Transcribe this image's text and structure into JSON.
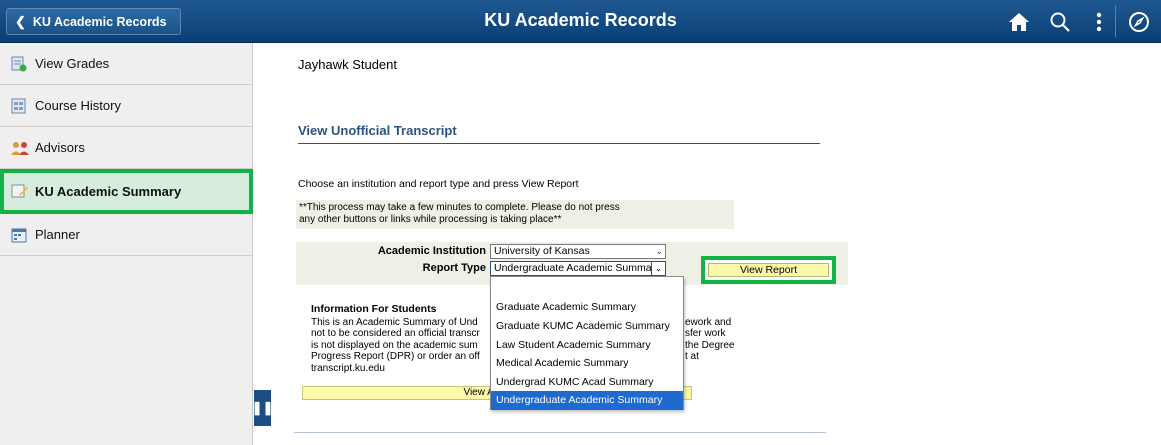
{
  "header": {
    "back_label": "KU Academic Records",
    "title": "KU Academic Records",
    "icons": [
      "home-icon",
      "search-icon",
      "more-menu-icon",
      "navigator-icon"
    ]
  },
  "sidebar": {
    "items": [
      {
        "label": "View Grades",
        "icon": "grades-icon"
      },
      {
        "label": "Course History",
        "icon": "course-history-icon"
      },
      {
        "label": "Advisors",
        "icon": "advisors-icon"
      },
      {
        "label": "KU Academic Summary",
        "icon": "summary-icon",
        "active": true
      },
      {
        "label": "Planner",
        "icon": "planner-icon"
      }
    ]
  },
  "main": {
    "student_name": "Jayhawk Student",
    "section_title": "View Unofficial Transcript",
    "instructions": "Choose an institution and report type and press View Report",
    "note_line1": "**This process may take a few minutes to complete. Please do not press",
    "note_line2": "any other buttons or links while processing is taking place**",
    "institution_label": "Academic Institution",
    "institution_value": "University of Kansas",
    "report_type_label": "Report Type",
    "report_type_value": "Undergraduate Academic Summa",
    "view_report_label": "View Report",
    "info_title": "Information For Students",
    "info_lines": [
      "This is an Academic Summary of Und",
      "not to be considered an official transcr",
      "is not displayed on the academic sum",
      "Progress Report (DPR) or order an off",
      "transcript.ku.edu"
    ],
    "info_lines_right": [
      "ework and",
      "sfer work",
      "the Degree",
      "t at"
    ],
    "view_all_label": "View All Reque",
    "dropdown_options": [
      "",
      "Graduate Academic Summary",
      "Graduate KUMC Academic Summary",
      "Law Student Academic Summary",
      "Medical Academic Summary",
      "Undergrad KUMC Acad Summary",
      "Undergraduate Academic Summary"
    ],
    "dropdown_selected_index": 6
  },
  "colors": {
    "header": "#0a3f76",
    "highlight": "#13b245",
    "section_title": "#2b5283",
    "button_fill": "#fcf9a8",
    "selected_option": "#1e6ad0"
  }
}
